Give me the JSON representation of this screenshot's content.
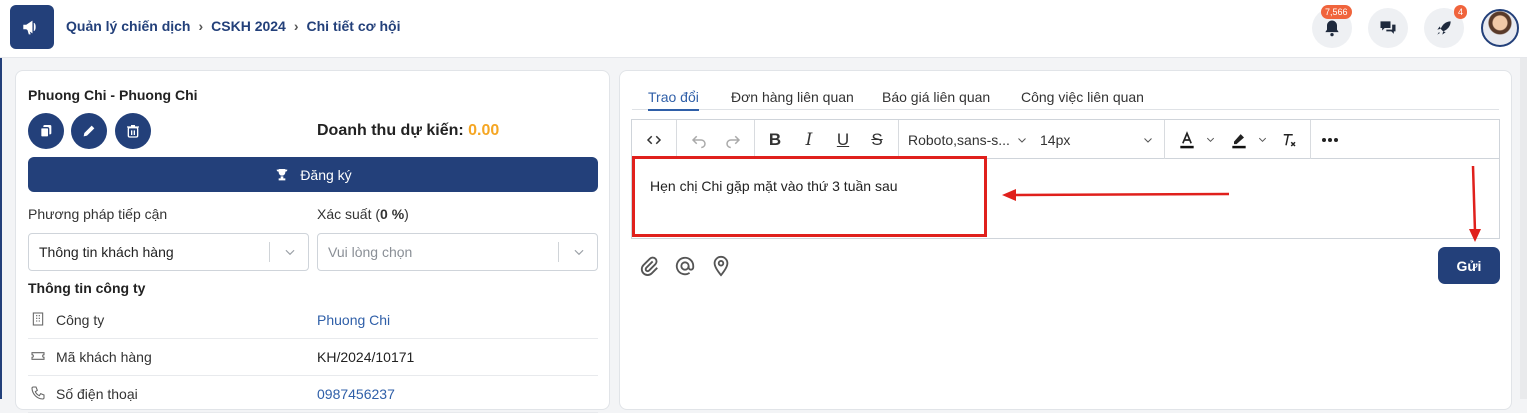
{
  "header": {
    "breadcrumb": [
      "Quản lý chiến dịch",
      "CSKH 2024",
      "Chi tiết cơ hội"
    ],
    "notifications_count": "7,566",
    "rocket_count": "4",
    "icons": [
      "megaphone-icon",
      "bell-icon",
      "chat-icon",
      "rocket-icon",
      "avatar"
    ]
  },
  "left": {
    "title": "Phuong Chi - Phuong Chi",
    "revenue_label": "Doanh thu dự kiến:",
    "revenue_value": "0.00",
    "register_label": "Đăng ký",
    "approach_label": "Phương pháp tiếp cận",
    "approach_value": "Thông tin khách hàng",
    "probability_label_prefix": "Xác suất (",
    "probability_value": "0 %",
    "probability_label_suffix": ")",
    "probability_placeholder": "Vui lòng chọn",
    "company_section": "Thông tin công ty",
    "rows": [
      {
        "label": "Công ty",
        "value": "Phuong Chi"
      },
      {
        "label": "Mã khách hàng",
        "value": "KH/2024/10171"
      },
      {
        "label": "Số điện thoại",
        "value": "0987456237"
      }
    ]
  },
  "right": {
    "tabs": [
      "Trao đổi",
      "Đơn hàng liên quan",
      "Báo giá liên quan",
      "Công việc liên quan"
    ],
    "toolbar": {
      "font_family": "Roboto,sans-s...",
      "font_size": "14px",
      "bold": "B",
      "italic": "I",
      "underline": "U",
      "strike": "S"
    },
    "content": "Hẹn chị Chi gặp mặt vào thứ 3 tuần sau",
    "send_label": "Gửi"
  },
  "colors": {
    "primary": "#23407a",
    "accent": "#f5a623",
    "annotation": "#e0201c"
  }
}
